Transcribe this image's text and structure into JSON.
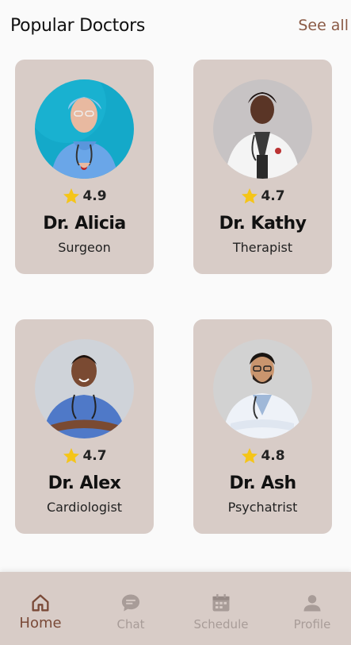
{
  "header": {
    "title": "Popular Doctors",
    "see_all": "See all"
  },
  "colors": {
    "card_bg": "#d8ccc7",
    "star": "#f5c518",
    "accent": "#7a4a38",
    "inactive": "#a89c98"
  },
  "doctors": [
    {
      "name": "Dr. Alicia",
      "specialty": "Surgeon",
      "rating": "4.9",
      "avatar": "doctor-photo-scrubs-teal"
    },
    {
      "name": "Dr. Kathy",
      "specialty": "Therapist",
      "rating": "4.7",
      "avatar": "doctor-photo-white-coat"
    },
    {
      "name": "Dr. Alex",
      "specialty": "Cardiologist",
      "rating": "4.7",
      "avatar": "doctor-photo-blue-scrubs"
    },
    {
      "name": "Dr. Ash",
      "specialty": "Psychatrist",
      "rating": "4.8",
      "avatar": "doctor-photo-lab-coat"
    }
  ],
  "nav": {
    "items": [
      {
        "label": "Home",
        "icon": "home-icon",
        "active": true
      },
      {
        "label": "Chat",
        "icon": "chat-icon",
        "active": false
      },
      {
        "label": "Schedule",
        "icon": "calendar-icon",
        "active": false
      },
      {
        "label": "Profile",
        "icon": "person-icon",
        "active": false
      }
    ]
  }
}
